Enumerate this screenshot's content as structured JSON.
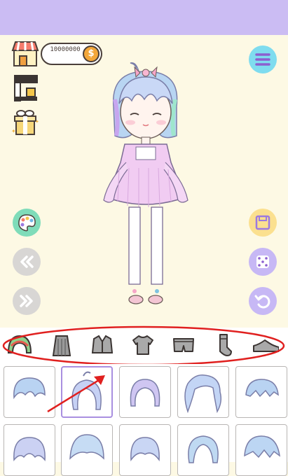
{
  "coins": {
    "amount": "10000000"
  },
  "menu": {
    "icon": "hamburger-menu-icon"
  },
  "left_icons": [
    "shop-icon",
    "coffee-machine-icon",
    "gift-icon"
  ],
  "stage_buttons": {
    "left": [
      "palette-icon",
      "rewind-icon",
      "fast-forward-icon"
    ],
    "right": [
      "save-icon",
      "dice-icon",
      "undo-icon"
    ]
  },
  "tabs": [
    {
      "name": "hair",
      "icon": "hair-icon"
    },
    {
      "name": "dress",
      "icon": "dress-icon"
    },
    {
      "name": "jacket",
      "icon": "jacket-icon"
    },
    {
      "name": "top",
      "icon": "tshirt-icon"
    },
    {
      "name": "bottoms",
      "icon": "shorts-icon"
    },
    {
      "name": "socks",
      "icon": "sock-icon"
    },
    {
      "name": "shoes",
      "icon": "shoe-icon"
    }
  ],
  "colors": {
    "topbar": "#cbbcf3",
    "stage": "#fdf9e4",
    "accent": "#a98fe0",
    "palette_btn": "#7fdcb9",
    "save_btn": "#fbe08f",
    "side_btn": "#c7b8f5",
    "grey_btn": "#d8d6d4",
    "annotation": "#e0201f"
  },
  "hair_items": 10,
  "selected_hair": 2
}
